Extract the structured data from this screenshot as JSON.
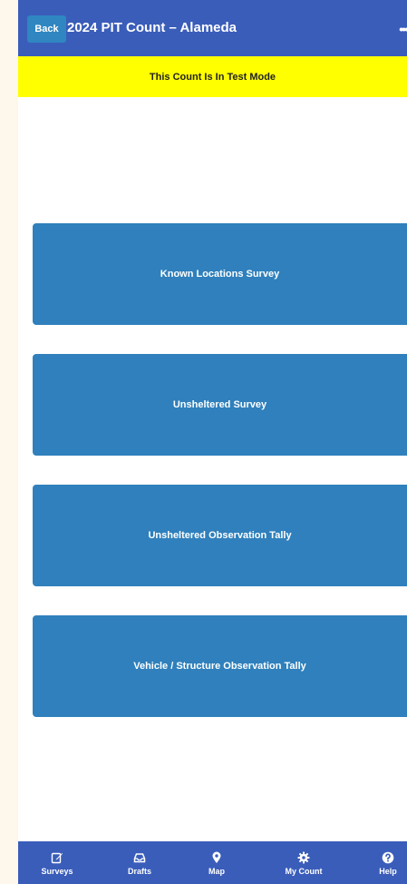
{
  "header": {
    "back_label": "Back",
    "title": "2024 PIT Count – Alameda",
    "more_icon": "ellipsis-icon"
  },
  "banner": {
    "text": "This Count Is In Test Mode"
  },
  "surveys": [
    {
      "label": "Known Locations Survey"
    },
    {
      "label": "Unsheltered Survey"
    },
    {
      "label": "Unsheltered Observation Tally"
    },
    {
      "label": "Vehicle / Structure Observation Tally"
    }
  ],
  "tabs": [
    {
      "label": "Surveys",
      "icon": "edit-icon"
    },
    {
      "label": "Drafts",
      "icon": "inbox-icon"
    },
    {
      "label": "Map",
      "icon": "map-pin-icon"
    },
    {
      "label": "My Count",
      "icon": "gear-icon"
    },
    {
      "label": "Help",
      "icon": "help-icon"
    }
  ],
  "colors": {
    "header": "#3a5dba",
    "banner": "#ffff00",
    "button": "#2f80bc",
    "back_button": "#2f86c1",
    "page_bg": "#fdf7ec"
  }
}
